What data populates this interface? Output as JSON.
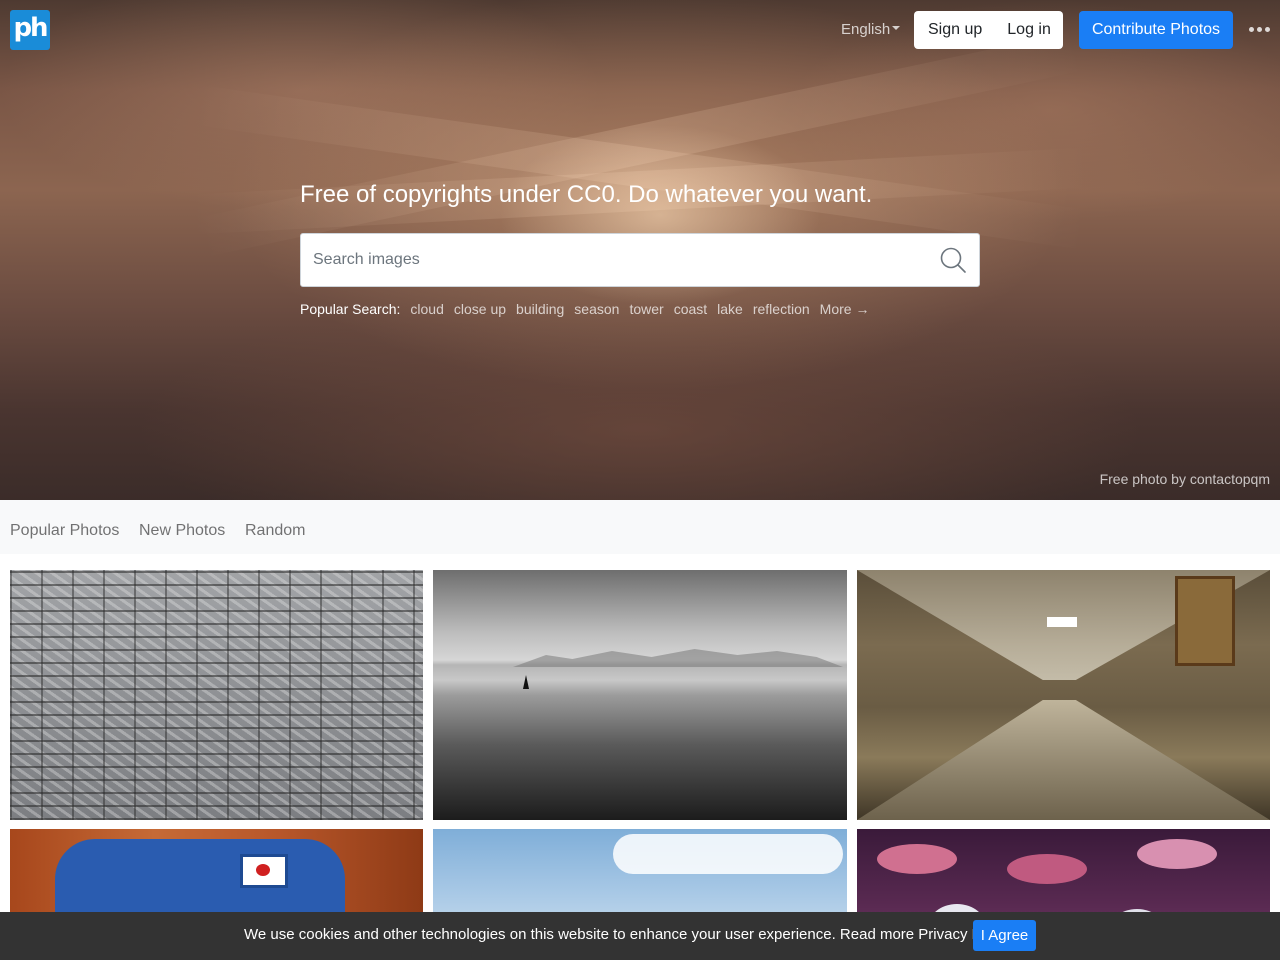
{
  "header": {
    "logo": "ph",
    "language": "English",
    "sign_up": "Sign up",
    "log_in": "Log in",
    "contribute": "Contribute Photos",
    "more_icon": "more-horizontal-icon"
  },
  "hero": {
    "tagline": "Free of copyrights under CC0. Do whatever you want.",
    "search_placeholder": "Search images",
    "popular_label": "Popular Search:",
    "popular_tags": [
      "cloud",
      "close up",
      "building",
      "season",
      "tower",
      "coast",
      "lake",
      "reflection"
    ],
    "more_link": "More →",
    "credit": "Free photo by contactopqm"
  },
  "nav": {
    "tabs": [
      "Popular Photos",
      "New Photos",
      "Random"
    ]
  },
  "cookie": {
    "message": "We use cookies and other technologies on this website to enhance your user experience. Read more Privacy Policy.",
    "agree": "I Agree"
  },
  "colors": {
    "accent": "#1a7ef5",
    "logo": "#1a8cd8",
    "cookie_bar": "#333333"
  }
}
